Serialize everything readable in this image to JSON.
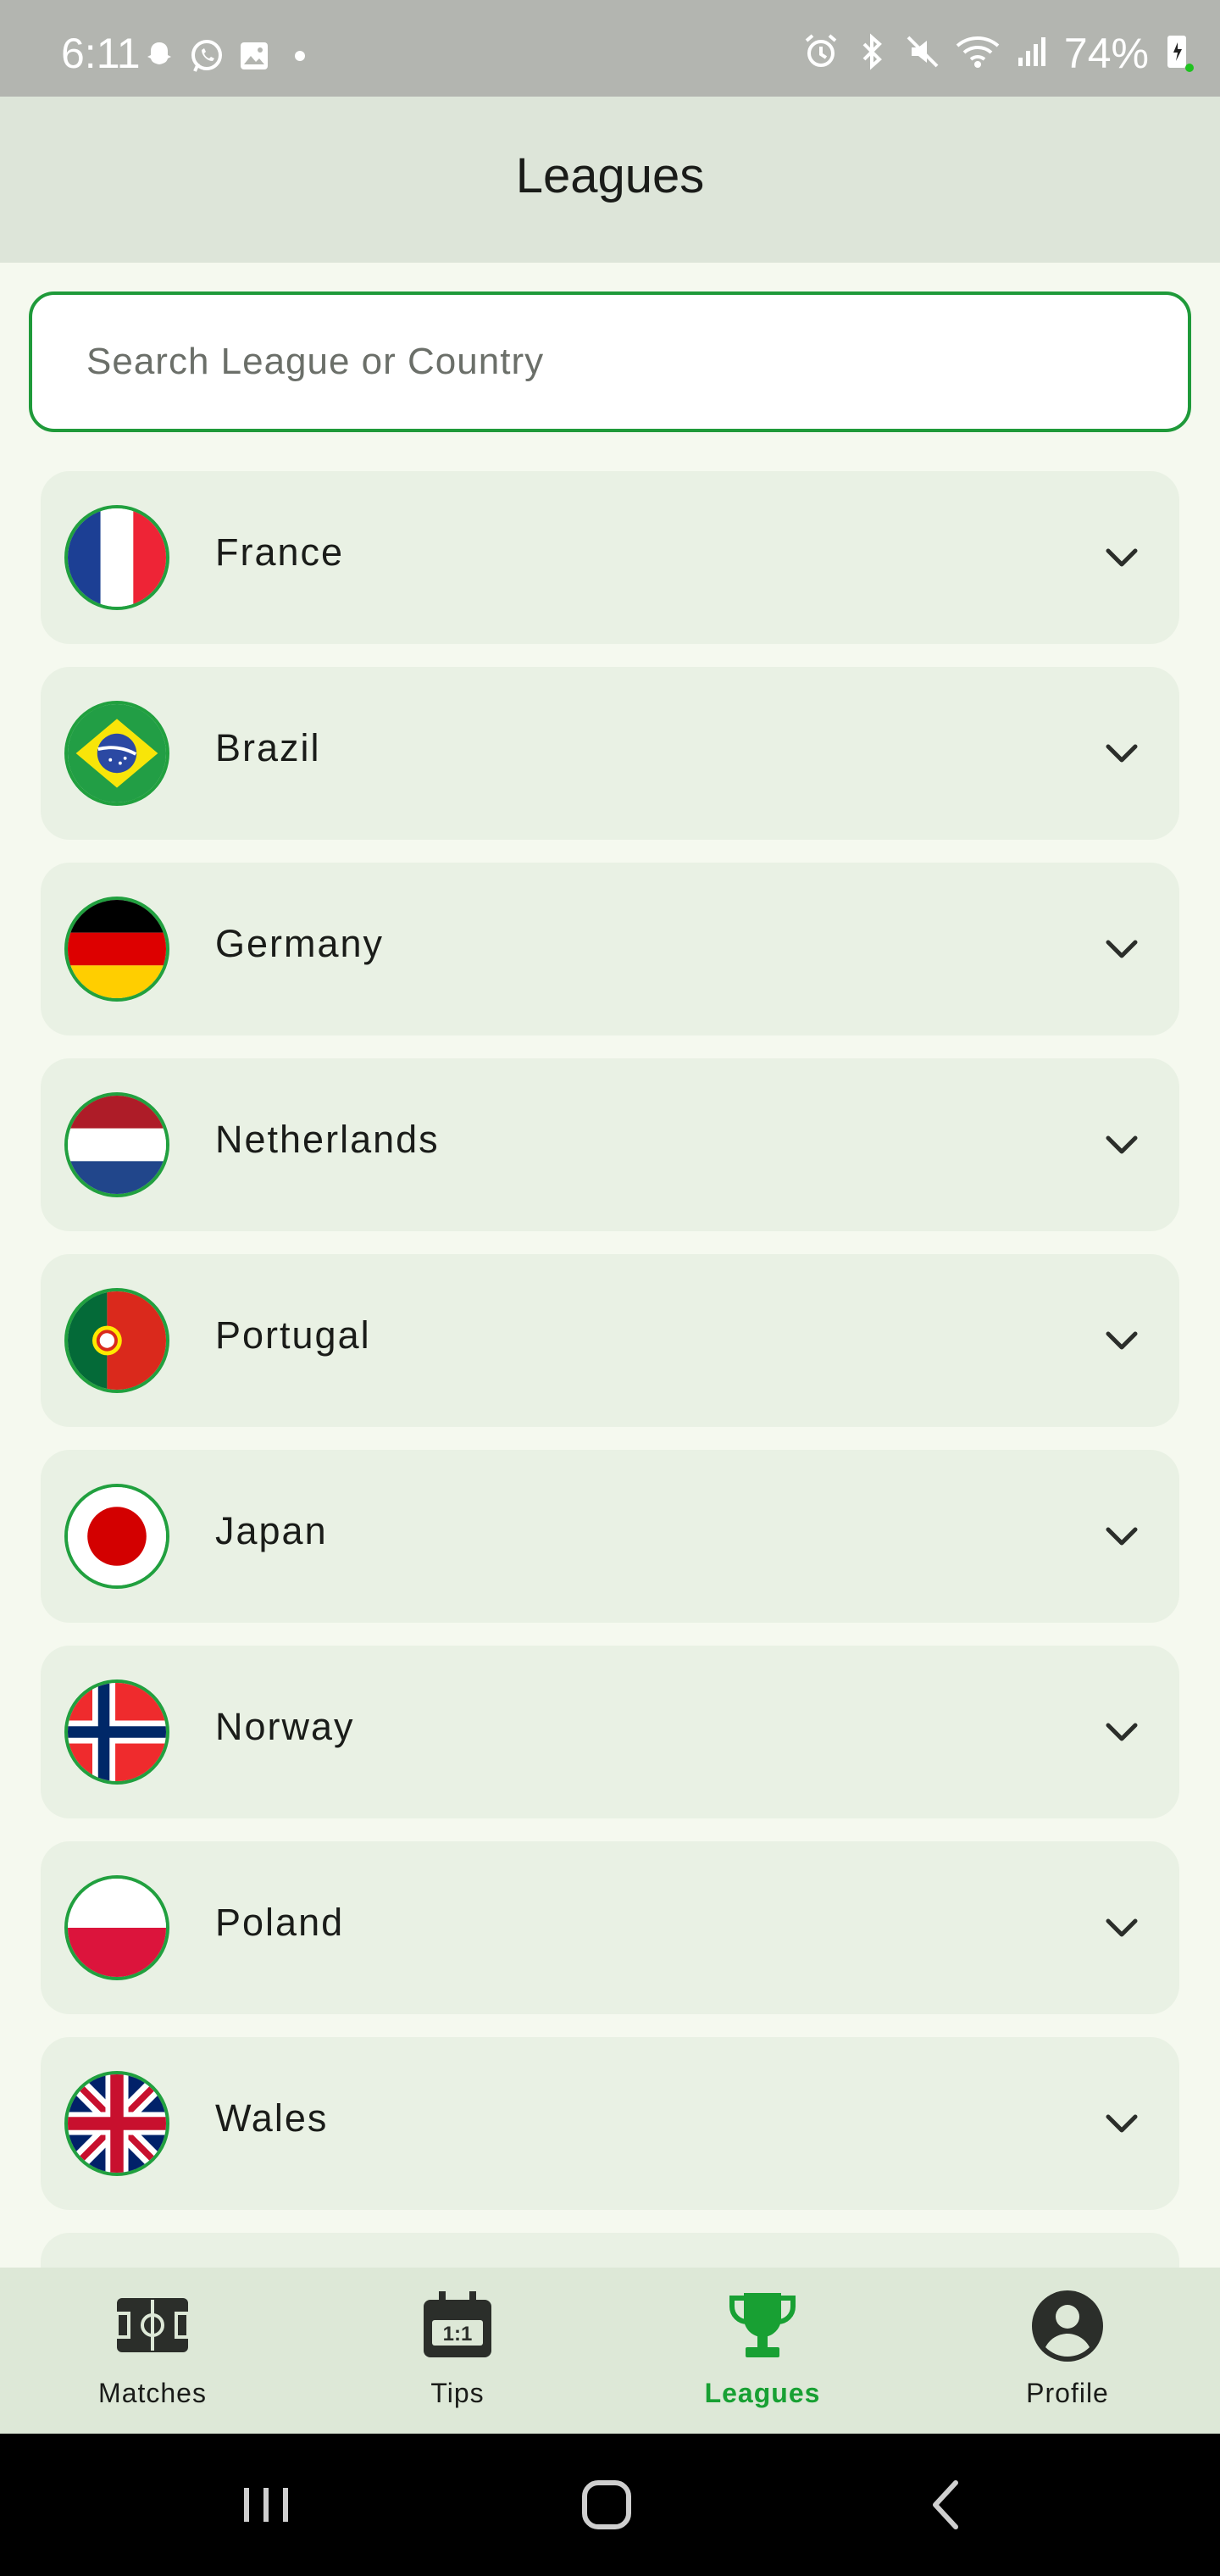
{
  "status_bar": {
    "time": "6:11",
    "battery": "74%",
    "left_icons": [
      "snapchat-icon",
      "whatsapp-icon",
      "gallery-icon",
      "dot-icon"
    ],
    "right_icons": [
      "alarm-icon",
      "bluetooth-icon",
      "mute-icon",
      "wifi-icon",
      "signal-icon",
      "battery-icon"
    ]
  },
  "header": {
    "title": "Leagues"
  },
  "search": {
    "placeholder": "Search League or Country",
    "value": ""
  },
  "countries": [
    {
      "name": "France",
      "flag": "france-flag"
    },
    {
      "name": "Brazil",
      "flag": "brazil-flag"
    },
    {
      "name": "Germany",
      "flag": "germany-flag"
    },
    {
      "name": "Netherlands",
      "flag": "netherlands-flag"
    },
    {
      "name": "Portugal",
      "flag": "portugal-flag"
    },
    {
      "name": "Japan",
      "flag": "japan-flag"
    },
    {
      "name": "Norway",
      "flag": "norway-flag"
    },
    {
      "name": "Poland",
      "flag": "poland-flag"
    },
    {
      "name": "Wales",
      "flag": "union-jack-flag"
    }
  ],
  "bottom_nav": {
    "items": [
      {
        "label": "Matches",
        "icon": "pitch-icon",
        "active": false
      },
      {
        "label": "Tips",
        "icon": "scoreboard-icon",
        "active": false
      },
      {
        "label": "Leagues",
        "icon": "trophy-icon",
        "active": true
      },
      {
        "label": "Profile",
        "icon": "account-icon",
        "active": false
      }
    ]
  },
  "colors": {
    "accent": "#1f9a3a",
    "header_bg": "#dde5d9",
    "card_bg": "#e9f1e4",
    "page_bg": "#f5f9ef",
    "nav_bg": "#dde8d7",
    "status_bar_bg": "#b3b5b0"
  }
}
